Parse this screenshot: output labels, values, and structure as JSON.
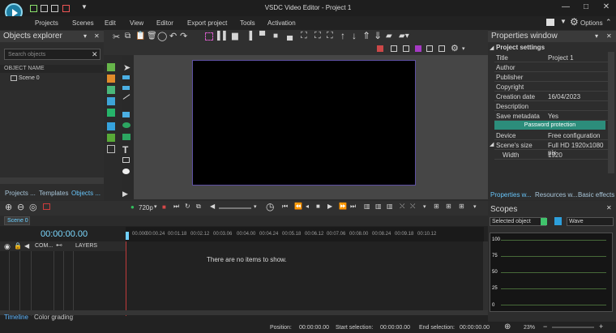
{
  "app": {
    "title": "VSDC Video Editor - Project 1",
    "options_label": "Options"
  },
  "menu": [
    "Projects",
    "Scenes",
    "Edit",
    "View",
    "Editor",
    "Export project",
    "Tools",
    "Activation"
  ],
  "objects_explorer": {
    "title": "Objects explorer",
    "search_placeholder": "Search objects",
    "column_header": "OBJECT NAME",
    "items": [
      "Scene 0"
    ],
    "tabs": [
      "Projects ...",
      "Templates",
      "Objects ..."
    ]
  },
  "properties": {
    "title": "Properties window",
    "section": "Project settings",
    "rows": [
      {
        "label": "Title",
        "value": "Project 1"
      },
      {
        "label": "Author",
        "value": ""
      },
      {
        "label": "Publisher",
        "value": ""
      },
      {
        "label": "Copyright",
        "value": ""
      },
      {
        "label": "Creation date",
        "value": "16/04/2023"
      },
      {
        "label": "Description",
        "value": ""
      },
      {
        "label": "Save metadata",
        "value": "Yes"
      }
    ],
    "password_button": "Password protection",
    "rows2": [
      {
        "label": "Device",
        "value": "Free configuration"
      },
      {
        "label": "Scene's size",
        "value": "Full HD 1920x1080 pix"
      },
      {
        "label": "Width",
        "value": "1920"
      }
    ],
    "tabs": [
      "Properties w...",
      "Resources w...",
      "Basic effects"
    ]
  },
  "timeline": {
    "scene_tab": "Scene 0",
    "timecode": "00:00:00.00",
    "resolution": "720p",
    "columns": {
      "com": "COM...",
      "layers": "LAYERS"
    },
    "empty_message": "There are no items to show.",
    "ruler_labels": [
      "00.000",
      "00:00.24",
      "00:01.18",
      "00:02.12",
      "00:03.06",
      "00:04.00",
      "00:04.24",
      "00:05.18",
      "00:06.12",
      "00:07.06",
      "00:08.00",
      "00:08.24",
      "00:09.18",
      "00:10.12"
    ]
  },
  "scopes": {
    "title": "Scopes",
    "selected_object": "Selected object",
    "mode": "Wave",
    "y_labels": [
      "100",
      "75",
      "50",
      "25",
      "0"
    ]
  },
  "bottom_tabs": [
    "Timeline",
    "Color grading"
  ],
  "status": {
    "position_label": "Position:",
    "position": "00:00:00.00",
    "start_label": "Start selection:",
    "start": "00:00:00.00",
    "end_label": "End selection:",
    "end": "00:00:00.00",
    "zoom": "23%"
  }
}
